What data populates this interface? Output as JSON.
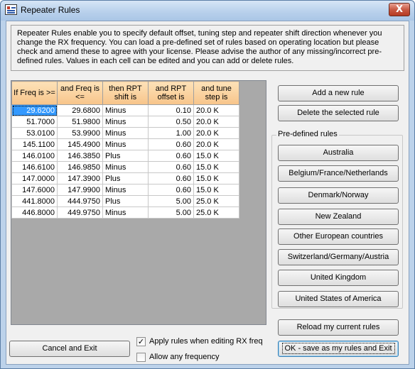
{
  "window": {
    "title": "Repeater Rules",
    "close_label": "X"
  },
  "description": "Repeater Rules enable you to specify default offset, tuning step and repeater shift direction whenever you change the RX frequency.  You can load a pre-defined set of rules based on operating location but please check and amend these to agree with your license.  Please advise the author of any missing/incorrect pre-defined rules.  Values in each cell can be edited and you can add or delete rules.",
  "table": {
    "headers": [
      "If Freq is >=",
      "and Freq is <=",
      "then RPT shift is",
      "and RPT offset is",
      "and tune step is"
    ],
    "rows": [
      [
        "29.6200",
        "29.6800",
        "Minus",
        "0.10",
        "20.0 K"
      ],
      [
        "51.7000",
        "51.9800",
        "Minus",
        "0.50",
        "20.0 K"
      ],
      [
        "53.0100",
        "53.9900",
        "Minus",
        "1.00",
        "20.0 K"
      ],
      [
        "145.1100",
        "145.4900",
        "Minus",
        "0.60",
        "20.0 K"
      ],
      [
        "146.0100",
        "146.3850",
        "Plus",
        "0.60",
        "15.0 K"
      ],
      [
        "146.6100",
        "146.9850",
        "Minus",
        "0.60",
        "15.0 K"
      ],
      [
        "147.0000",
        "147.3900",
        "Plus",
        "0.60",
        "15.0 K"
      ],
      [
        "147.6000",
        "147.9900",
        "Minus",
        "0.60",
        "15.0 K"
      ],
      [
        "441.8000",
        "444.9750",
        "Plus",
        "5.00",
        "25.0 K"
      ],
      [
        "446.8000",
        "449.9750",
        "Minus",
        "5.00",
        "25.0 K"
      ]
    ]
  },
  "buttons": {
    "add_rule": "Add a new rule",
    "delete_rule": "Delete the selected rule",
    "reload": "Reload my current rules",
    "ok_save": "OK - save as my rules and Exit",
    "cancel": "Cancel and Exit"
  },
  "predefined": {
    "label": "Pre-defined rules",
    "items": [
      "Australia",
      "Belgium/France/Netherlands",
      "Denmark/Norway",
      "New Zealand",
      "Other European countries",
      "Switzerland/Germany/Austria",
      "United Kingdom",
      "United States of America"
    ]
  },
  "options": {
    "apply_rules": {
      "label": "Apply rules when editing RX freq",
      "checked": true,
      "mark": "✓"
    },
    "allow_any": {
      "label": "Allow any frequency",
      "checked": false,
      "mark": ""
    }
  }
}
